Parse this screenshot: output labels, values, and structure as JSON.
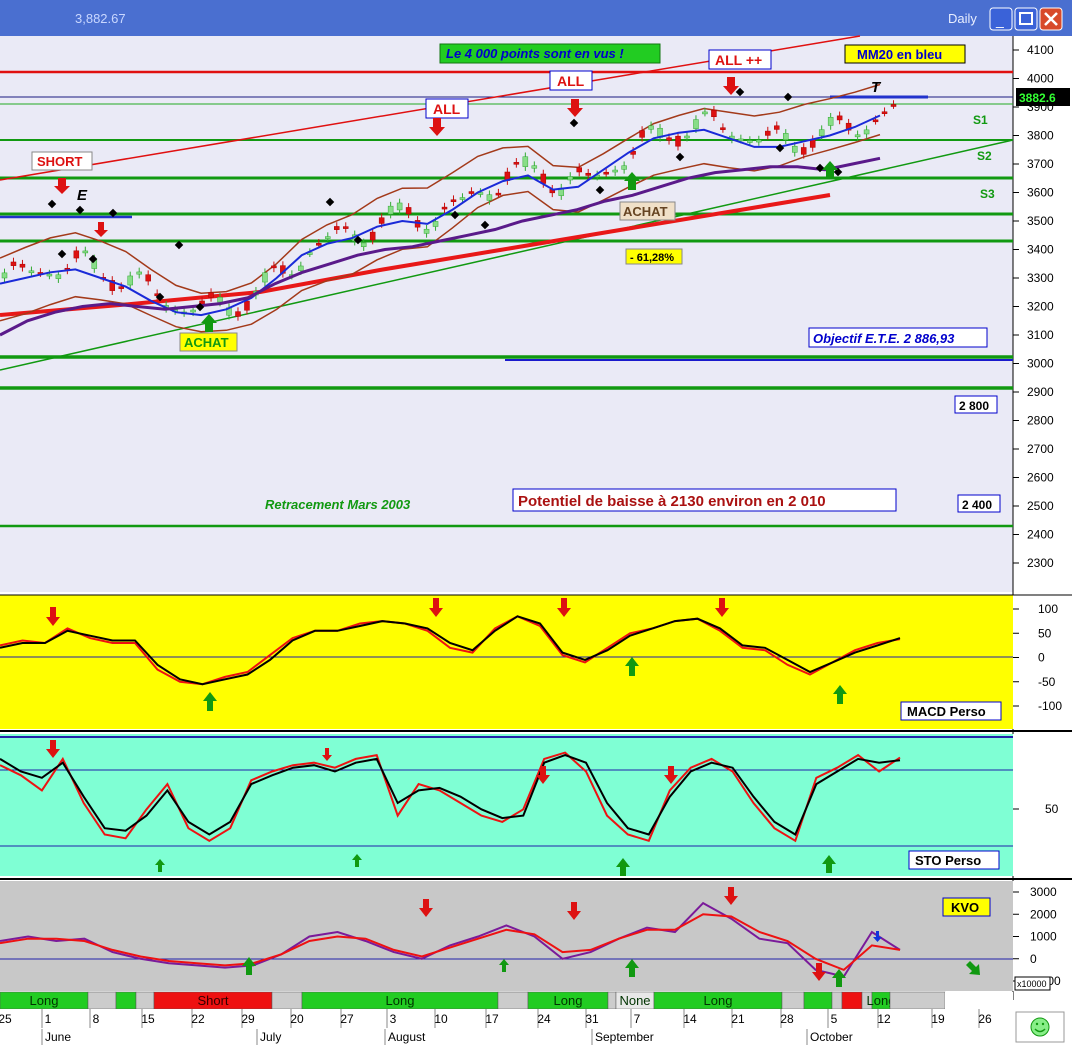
{
  "window": {
    "title_value": "3,882.67",
    "period": "Daily",
    "buttons": [
      "_",
      "□",
      "✕"
    ]
  },
  "price_panel": {
    "y_ticks": [
      "4100",
      "4000",
      "3900",
      "3800",
      "3700",
      "3600",
      "3500",
      "3400",
      "3300",
      "3200",
      "3100",
      "3000",
      "2900",
      "2800",
      "2700",
      "2600",
      "2500",
      "2400",
      "2300"
    ],
    "last_price_label": "3882.6",
    "annotations": {
      "headline": "Le 4 000 points sont en vus !",
      "mm20": "MM20 en bleu",
      "all_plus": "ALL ++",
      "all_1": "ALL",
      "all_2": "ALL",
      "short": "SHORT",
      "achat_1": "ACHAT",
      "achat_2": "ACHAT",
      "fib": "- 61,28%",
      "objectif": "Objectif E.T.E. 2 886,93",
      "label_2800": "2 800",
      "label_2400": "2 400",
      "retracement": "Retracement Mars 2003",
      "potentiel": "Potentiel de baisse à 2130 environ en 2 010",
      "s1": "S1",
      "s2": "S2",
      "s3": "S3",
      "e_letter": "E",
      "t_letter": "T"
    }
  },
  "macd_panel": {
    "label": "MACD Perso",
    "y_ticks": [
      "100",
      "50",
      "0",
      "-50",
      "-100"
    ]
  },
  "sto_panel": {
    "label": "STO Perso",
    "y_ticks": [
      "50"
    ]
  },
  "kvo_panel": {
    "label": "KVO",
    "y_ticks": [
      "3000",
      "2000",
      "1000",
      "0",
      "-1000"
    ],
    "multiplier": "x10000"
  },
  "signal_bar": [
    {
      "label": "Long",
      "color": "#22cc22"
    },
    {
      "label": "",
      "color": "#cccccc"
    },
    {
      "label": "",
      "color": "#22cc22"
    },
    {
      "label": "",
      "color": "#cccccc"
    },
    {
      "label": "Short",
      "color": "#ee1111"
    },
    {
      "label": "",
      "color": "#cccccc"
    },
    {
      "label": "Long",
      "color": "#22cc22"
    },
    {
      "label": "",
      "color": "#cccccc"
    },
    {
      "label": "Long",
      "color": "#22cc22"
    },
    {
      "label": "",
      "color": "#cccccc"
    },
    {
      "label": "None",
      "color": "#e8e8e8"
    },
    {
      "label": "Long",
      "color": "#22cc22"
    },
    {
      "label": "",
      "color": "#cccccc"
    },
    {
      "label": "",
      "color": "#22cc22"
    },
    {
      "label": "",
      "color": "#cccccc"
    },
    {
      "label": "",
      "color": "#ee1111"
    },
    {
      "label": "",
      "color": "#cccccc"
    },
    {
      "label": "Long",
      "color": "#22cc22"
    },
    {
      "label": "",
      "color": "#cccccc"
    }
  ],
  "x_axis": {
    "days": [
      "25",
      "1",
      "8",
      "15",
      "22",
      "29",
      "20",
      "27",
      "3",
      "10",
      "17",
      "24",
      "31",
      "7",
      "14",
      "21",
      "28",
      "5",
      "12",
      "19",
      "26"
    ],
    "months": [
      "June",
      "July",
      "August",
      "September",
      "October"
    ]
  },
  "chart_data": {
    "type": "line",
    "title": "",
    "series": [
      {
        "name": "MM20 en bleu",
        "values": [
          3280,
          3300,
          3320,
          3330,
          3300,
          3270,
          3220,
          3180,
          3170,
          3190,
          3230,
          3300,
          3380,
          3420,
          3440,
          3480,
          3500,
          3490,
          3540,
          3600,
          3640,
          3660,
          3610,
          3620,
          3680,
          3740,
          3790,
          3810,
          3820,
          3790,
          3760,
          3760,
          3780,
          3800,
          3830,
          3870
        ]
      },
      {
        "name": "",
        "values": [
          3100,
          3150,
          3180,
          3200,
          3210,
          3200,
          3190,
          3200,
          3210,
          3230,
          3280,
          3320,
          3350,
          3380,
          3400,
          3410,
          3430,
          3450,
          3470,
          3500,
          3520,
          3540,
          3570,
          3590,
          3620,
          3650,
          3670,
          3680,
          3690,
          3690,
          3680,
          3700,
          3720
        ]
      }
    ],
    "price_ylim": [
      2250,
      4150
    ],
    "macd_ylim": [
      -140,
      130
    ],
    "macd_black": [
      20,
      30,
      30,
      55,
      45,
      35,
      35,
      -15,
      -45,
      -55,
      -45,
      -35,
      -5,
      35,
      55,
      55,
      65,
      75,
      70,
      60,
      30,
      15,
      55,
      85,
      70,
      10,
      -5,
      15,
      45,
      60,
      75,
      80,
      60,
      25,
      20,
      -5,
      -30,
      -10,
      10,
      25,
      40
    ],
    "macd_red": [
      25,
      35,
      30,
      60,
      40,
      30,
      30,
      -25,
      -50,
      -55,
      -40,
      -30,
      5,
      40,
      55,
      55,
      70,
      75,
      70,
      55,
      20,
      10,
      60,
      85,
      65,
      5,
      -10,
      20,
      50,
      60,
      75,
      80,
      55,
      20,
      15,
      -15,
      -35,
      -10,
      15,
      30,
      38
    ],
    "sto_black": [
      85,
      75,
      70,
      82,
      55,
      30,
      28,
      40,
      60,
      35,
      25,
      35,
      65,
      72,
      78,
      80,
      75,
      82,
      85,
      50,
      60,
      62,
      55,
      45,
      38,
      40,
      82,
      88,
      82,
      50,
      30,
      25,
      55,
      75,
      82,
      78,
      55,
      35,
      25,
      65,
      75,
      85,
      82,
      84
    ],
    "sto_red": [
      80,
      72,
      60,
      85,
      50,
      25,
      22,
      45,
      65,
      30,
      20,
      30,
      68,
      75,
      80,
      82,
      78,
      85,
      88,
      40,
      65,
      60,
      50,
      40,
      35,
      45,
      85,
      90,
      75,
      40,
      25,
      20,
      60,
      78,
      85,
      75,
      50,
      30,
      20,
      70,
      78,
      88,
      75,
      86
    ],
    "kvo_purple": [
      800,
      1000,
      800,
      900,
      300,
      0,
      -200,
      -300,
      -400,
      -300,
      200,
      1000,
      1200,
      800,
      300,
      0,
      600,
      1000,
      1500,
      1000,
      0,
      300,
      900,
      1400,
      1200,
      2500,
      1800,
      900,
      700,
      -500,
      -800,
      1200,
      400
    ],
    "kvo_red": [
      700,
      900,
      900,
      800,
      400,
      100,
      -100,
      -200,
      -300,
      -200,
      200,
      800,
      1000,
      900,
      400,
      100,
      500,
      900,
      1300,
      1100,
      300,
      400,
      900,
      1300,
      1300,
      2000,
      1900,
      1200,
      800,
      0,
      -500,
      600,
      400
    ]
  }
}
